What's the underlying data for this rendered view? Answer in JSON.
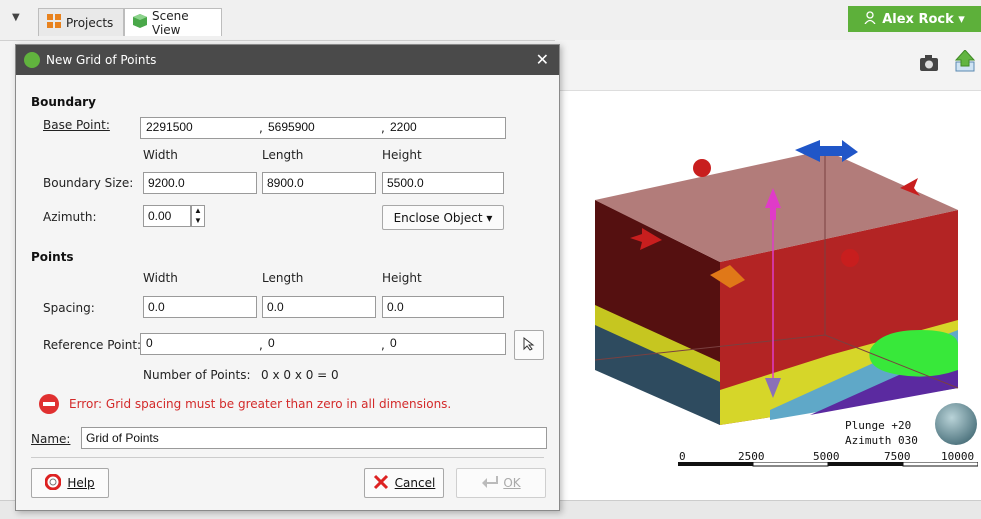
{
  "topbar": {
    "tabs": [
      {
        "label": "Projects",
        "icon": "projects-grid-icon"
      },
      {
        "label": "Scene View",
        "icon": "scene-cube-icon"
      }
    ],
    "user_button": "Alex Rock ▾"
  },
  "dialog": {
    "title": "New Grid of Points",
    "boundary_section": "Boundary",
    "base_point_label": "Base Point:",
    "base_point": {
      "x": "2291500",
      "y": "5695900",
      "z": "2200"
    },
    "col_headers": {
      "width": "Width",
      "length": "Length",
      "height": "Height"
    },
    "boundary_size_label": "Boundary Size:",
    "boundary_size": {
      "width": "9200.0",
      "length": "8900.0",
      "height": "5500.0"
    },
    "azimuth_label": "Azimuth:",
    "azimuth_value": "0.00",
    "enclose_object_label": "Enclose Object ▾",
    "points_section": "Points",
    "spacing_label": "Spacing:",
    "spacing": {
      "width": "0.0",
      "length": "0.0",
      "height": "0.0"
    },
    "reference_point_label": "Reference Point:",
    "reference_point": {
      "x": "0",
      "y": "0",
      "z": "0"
    },
    "number_of_points_label": "Number of Points:",
    "number_of_points_value": "0 x 0 x 0 = 0",
    "error_text": "Error: Grid spacing must be greater than zero in all dimensions.",
    "name_label": "Name:",
    "name_value": "Grid of Points",
    "help_label": "Help",
    "cancel_label": "Cancel",
    "ok_label": "OK"
  },
  "scene": {
    "plunge": "Plunge +20",
    "azimuth": "Azimuth 030",
    "scale_ticks": [
      "0",
      "2500",
      "5000",
      "7500",
      "10000"
    ]
  },
  "colors": {
    "accent_green": "#5db03a",
    "error_red": "#d32a2a",
    "box_top": "#a5605e",
    "box_red": "#b32424"
  }
}
